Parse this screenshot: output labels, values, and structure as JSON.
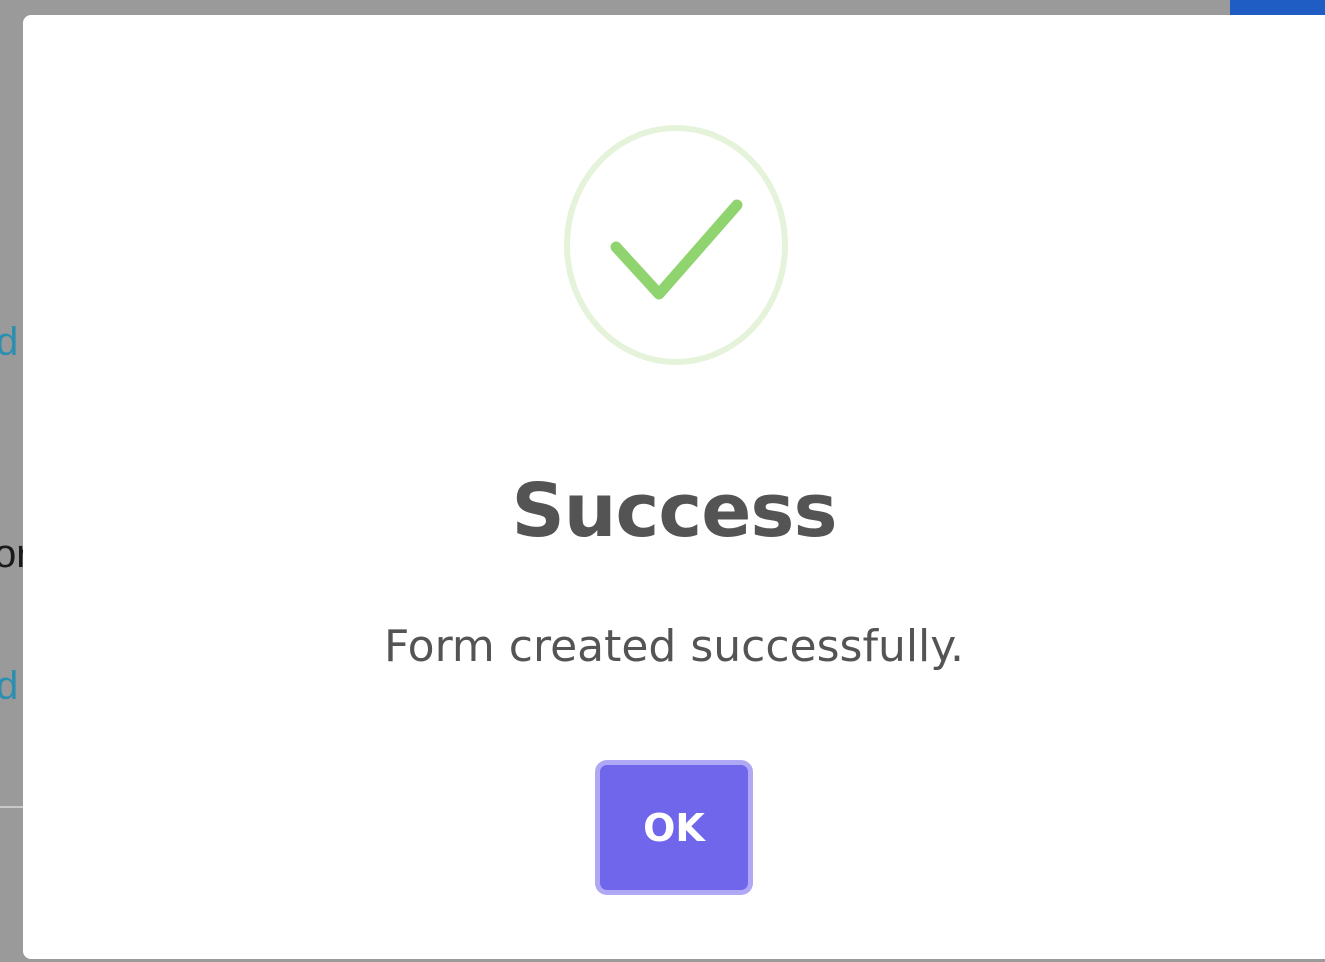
{
  "dialog": {
    "icon": "success-check-icon",
    "title": "Success",
    "message": "Form created successfully.",
    "confirm_label": "OK"
  },
  "colors": {
    "check": "#8fd46e",
    "ring": "#e5f3da",
    "button": "#7066ec",
    "button_focus_ring": "#b0a8f5",
    "text": "#545454"
  }
}
